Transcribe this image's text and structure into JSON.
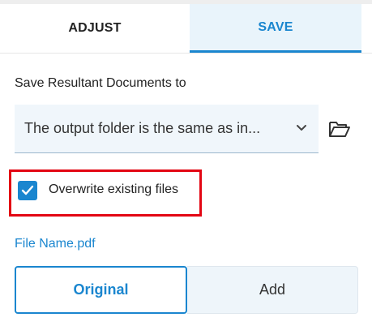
{
  "tabs": [
    {
      "label": "ADJUST",
      "active": false
    },
    {
      "label": "SAVE",
      "active": true
    }
  ],
  "save_section": {
    "label": "Save Resultant Documents to",
    "destination_value": "The output folder is the same as in..."
  },
  "overwrite": {
    "label": "Overwrite existing files",
    "checked": true
  },
  "file_name": {
    "link_text": "File Name.pdf"
  },
  "name_mode": {
    "options": [
      "Original",
      "Add"
    ],
    "selected": "Original"
  },
  "colors": {
    "accent": "#1a86cf",
    "highlight": "#e30613",
    "field_bg": "#f0f6fb"
  },
  "icons": {
    "dropdown": "chevron-down-icon",
    "browse": "folder-open-icon",
    "checkbox": "check-icon"
  }
}
